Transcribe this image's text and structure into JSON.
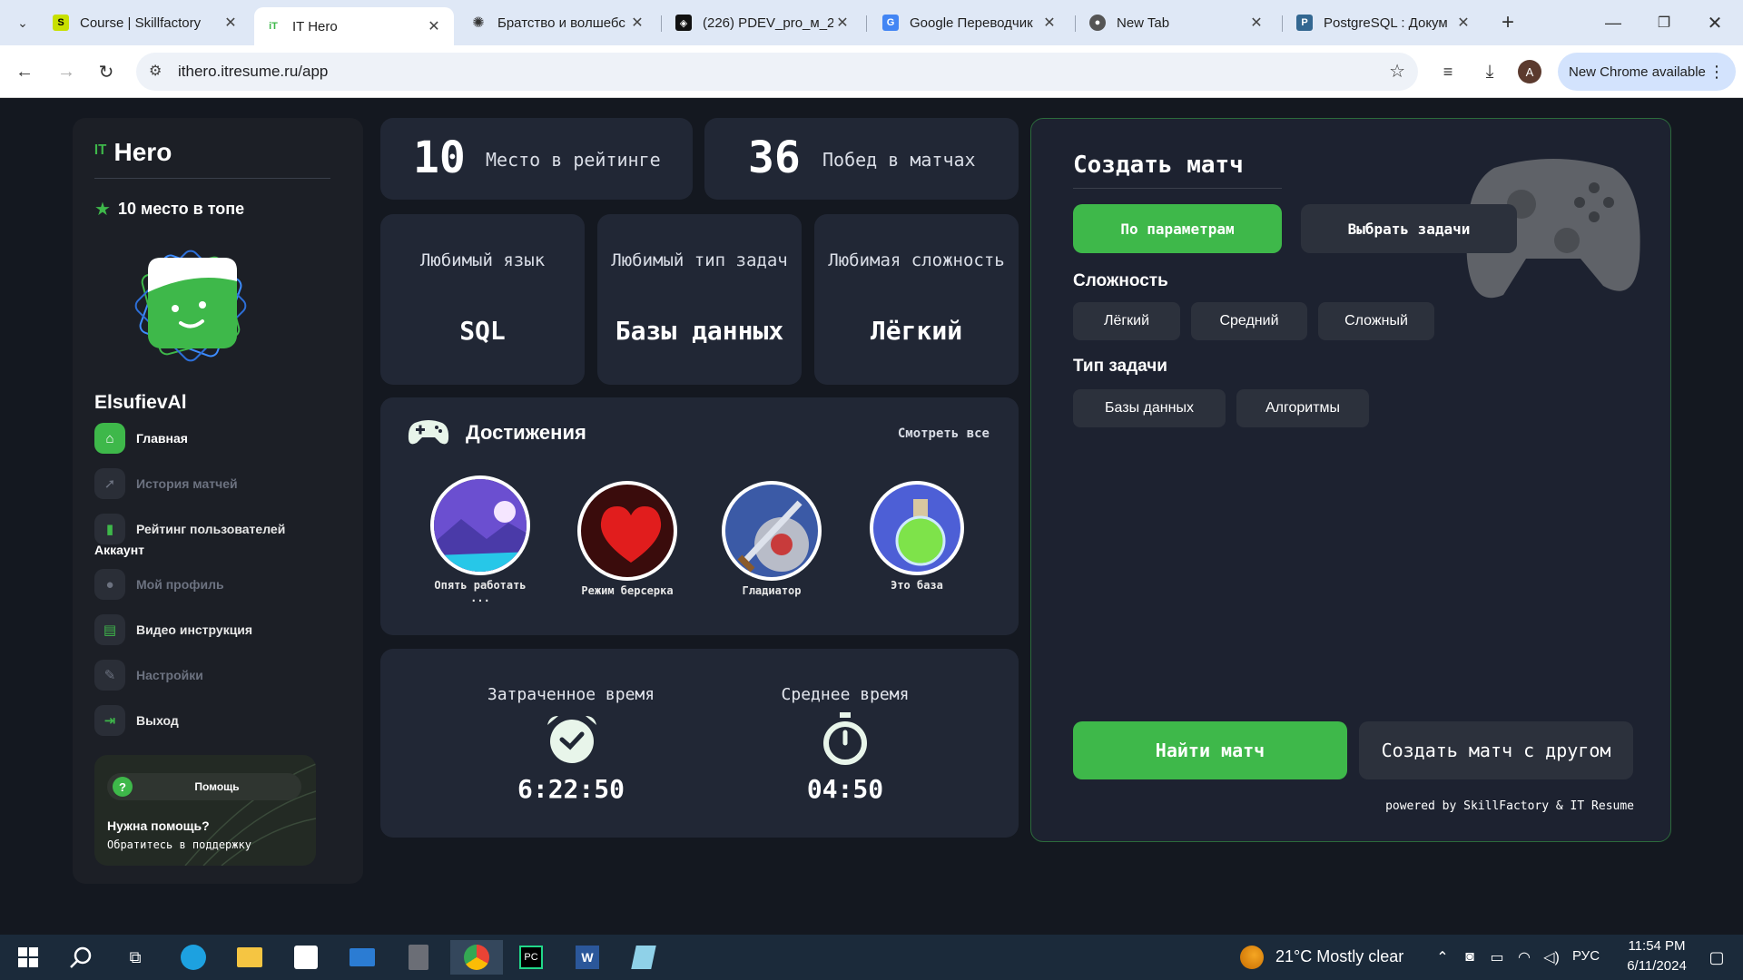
{
  "browser": {
    "tabs": [
      {
        "title": "Course | Skillfactory",
        "icon": "skillfactory-icon"
      },
      {
        "title": "IT Hero",
        "icon": "ithero-icon",
        "active": true
      },
      {
        "title": "Братство и волшебс",
        "icon": "openai-icon"
      },
      {
        "title": "(226) PDEV_pro_м_2",
        "icon": "layers-icon"
      },
      {
        "title": "Google Переводчик",
        "icon": "translate-icon"
      },
      {
        "title": "New Tab",
        "icon": "chrome-icon"
      },
      {
        "title": "PostgreSQL : Докум",
        "icon": "postgres-icon"
      }
    ],
    "url": "ithero.itresume.ru/app",
    "new_chrome_label": "New Chrome available",
    "profile_initial": "A"
  },
  "sidebar": {
    "logo_text": "Hero",
    "rank_text": "10 место в топе",
    "username": "ElsufievAl",
    "nav": [
      {
        "label": "Главная",
        "icon": "home-icon",
        "state": "active"
      },
      {
        "label": "История матчей",
        "icon": "rocket-icon",
        "state": "dim"
      },
      {
        "label": "Рейтинг пользователей",
        "icon": "chart-bars-icon",
        "state": "lit"
      }
    ],
    "account_title": "Аккаунт",
    "account_nav": [
      {
        "label": "Мой профиль",
        "icon": "user-icon",
        "state": "dim"
      },
      {
        "label": "Видео инструкция",
        "icon": "document-icon",
        "state": "lit"
      },
      {
        "label": "Настройки",
        "icon": "wrench-icon",
        "state": "dim"
      },
      {
        "label": "Выход",
        "icon": "logout-icon",
        "state": "lit"
      }
    ],
    "help": {
      "pill_label": "Помощь",
      "title": "Нужна помощь?",
      "subtitle": "Обратитесь в поддержку"
    }
  },
  "stats": {
    "rank_value": "10",
    "rank_label": "Место в рейтинге",
    "wins_value": "36",
    "wins_label": "Побед в матчах"
  },
  "favorites": [
    {
      "label": "Любимый язык",
      "value": "SQL"
    },
    {
      "label": "Любимый тип задач",
      "value": "Базы данных"
    },
    {
      "label": "Любимая сложность",
      "value": "Лёгкий"
    }
  ],
  "achievements": {
    "title": "Достижения",
    "see_all": "Смотреть все",
    "items": [
      {
        "caption": "Опять работать ...",
        "icon": "landscape-icon"
      },
      {
        "caption": "Режим берсерка",
        "icon": "heart-icon"
      },
      {
        "caption": "Гладиатор",
        "icon": "sword-shield-icon"
      },
      {
        "caption": "Это база",
        "icon": "potion-icon"
      }
    ]
  },
  "time": {
    "spent_label": "Затраченное время",
    "spent_value": "6:22:50",
    "avg_label": "Среднее время",
    "avg_value": "04:50"
  },
  "match": {
    "title": "Создать матч",
    "mode_buttons": [
      "По параметрам",
      "Выбрать задачи"
    ],
    "difficulty_label": "Сложность",
    "difficulty_options": [
      "Лёгкий",
      "Средний",
      "Сложный"
    ],
    "type_label": "Тип задачи",
    "type_options": [
      "Базы данных",
      "Алгоритмы"
    ],
    "find_button": "Найти матч",
    "friend_button": "Создать матч с другом",
    "powered_by": "powered by SkillFactory & IT Resume"
  },
  "taskbar": {
    "weather_temp": "21°C",
    "weather_text": "Mostly clear",
    "language": "РУС",
    "time": "11:54 PM",
    "date": "6/11/2024"
  },
  "colors": {
    "accent_green": "#3eb84a",
    "page_bg": "#141820",
    "card_bg": "#212735"
  }
}
